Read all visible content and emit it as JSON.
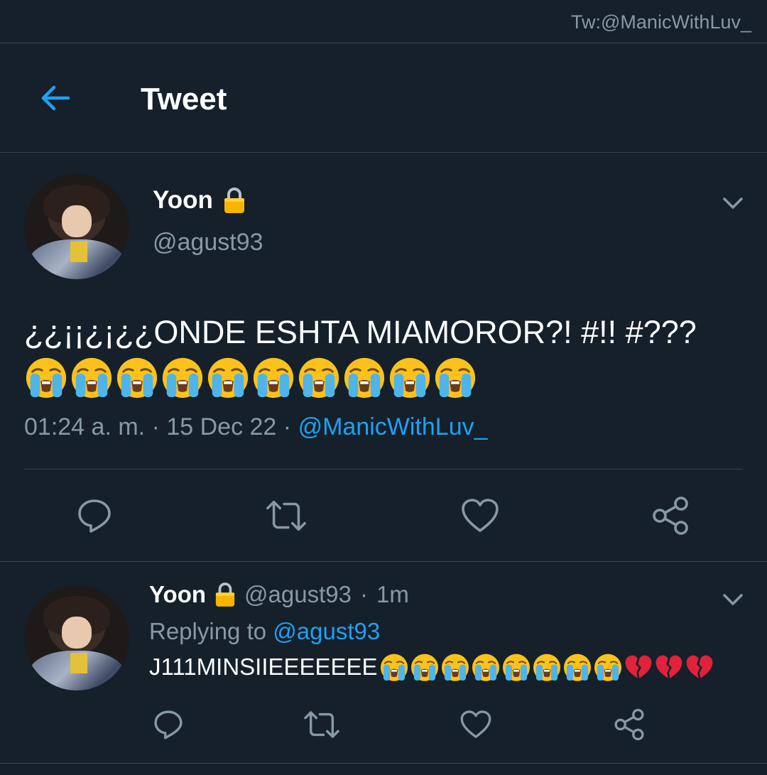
{
  "watermark": "Tw:@ManicWithLuv_",
  "header": {
    "title": "Tweet"
  },
  "main_tweet": {
    "display_name": "Yoon",
    "handle": "@agust93",
    "text": "¿¿¡¡¿¡¿¿ONDE ESHTA MIAMOROR?! #!! #???",
    "emoji_count_loudly_crying": 10,
    "time": "01:24 a. m.",
    "sep1": "·",
    "date": "15 Dec 22",
    "sep2": "·",
    "via": "@ManicWithLuv_"
  },
  "reply": {
    "display_name": "Yoon",
    "handle": "@agust93",
    "sep": "·",
    "age": "1m",
    "replying_label": "Replying to",
    "replying_to": "@agust93",
    "text": "J111MINSIIEEEEEEE",
    "emoji_count_loudly_crying": 8,
    "emoji_count_broken_heart": 3
  },
  "icons": {
    "back": "arrow-left-icon",
    "menu": "chevron-down-icon",
    "reply": "comment-icon",
    "retweet": "retweet-icon",
    "like": "heart-icon",
    "share": "share-icon",
    "lock": "lock-icon"
  },
  "colors": {
    "background": "#15202b",
    "accent": "#1da1f2",
    "muted": "#8899a6",
    "divider": "#38444d"
  }
}
